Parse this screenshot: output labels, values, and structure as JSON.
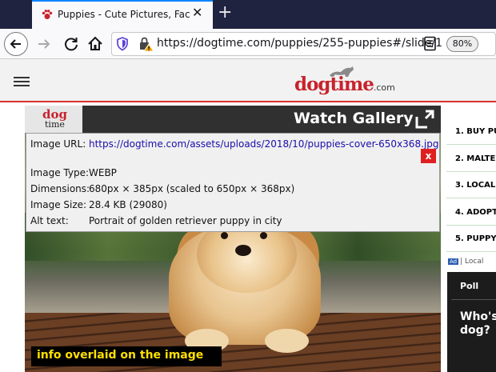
{
  "browser": {
    "tab_title": "Puppies - Cute Pictures, Facts, an",
    "url": "https://dogtime.com/puppies/255-puppies#/slide/1",
    "zoom": "80%",
    "accent_color": "#0a84ff",
    "icons": [
      "paw-icon",
      "close-icon",
      "plus-icon",
      "back-arrow-icon",
      "forward-arrow-icon",
      "reload-icon",
      "home-icon",
      "shield-icon",
      "lock-warning-icon",
      "reader-view-icon"
    ]
  },
  "site": {
    "logo_main": "dogtime",
    "logo_suffix": ".com",
    "brand_color": "#c8232c"
  },
  "gallery": {
    "logo_top": "dog",
    "logo_bottom": "time",
    "title": "Watch Gallery",
    "overlay_caption": "info overlaid on the image"
  },
  "info_popup": {
    "url_label": "Image URL:",
    "url_value": "https://dogtime.com/assets/uploads/2018/10/puppies-cover-650x368.jpg",
    "type_label": "Image Type:",
    "type_value": "WEBP",
    "dims_label": "Dimensions:",
    "dims_value": "680px × 385px (scaled to 650px × 368px)",
    "size_label": "Image Size:",
    "size_value": "28.4 KB (29080)",
    "alt_label": "Alt text:",
    "alt_value": "Portrait of golden retriever puppy in city",
    "close_label": "x"
  },
  "sidebar": {
    "items": [
      {
        "num": "1.",
        "label": "BUY PU"
      },
      {
        "num": "2.",
        "label": "MALTE"
      },
      {
        "num": "3.",
        "label": "LOCAL"
      },
      {
        "num": "4.",
        "label": "ADOPT"
      },
      {
        "num": "5.",
        "label": "PUPPY"
      }
    ],
    "ad_badge": "Ad",
    "ad_label": "| Local",
    "poll_title": "Poll",
    "poll_question": "Who's dog?"
  }
}
